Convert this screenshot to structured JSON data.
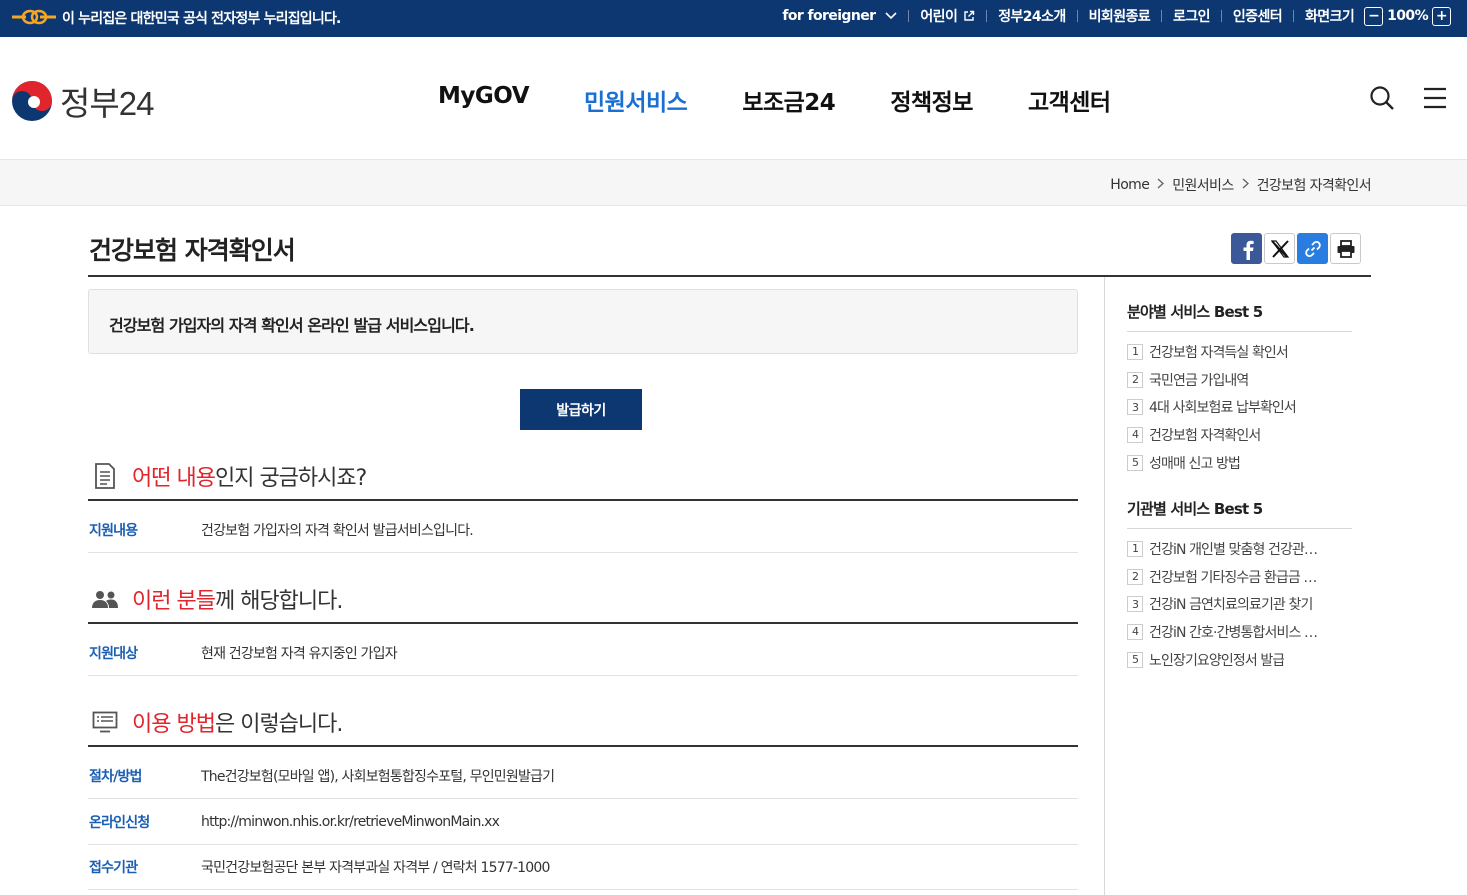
{
  "topbar": {
    "notice": "이 누리집은 대한민국 공식 전자정부 누리집입니다.",
    "foreigner": "for foreigner",
    "kids": "어린이",
    "about": "정부24소개",
    "nonmember_exit": "비회원종료",
    "login": "로그인",
    "cert_center": "인증센터",
    "screen_size": "화면크기",
    "zoom": "100%",
    "zoom_out": "−",
    "zoom_in": "+"
  },
  "header": {
    "logo_text": "정부24",
    "nav": [
      "MyGOV",
      "민원서비스",
      "보조금24",
      "정책정보",
      "고객센터"
    ],
    "active_nav": "민원서비스"
  },
  "breadcrumb": [
    "Home",
    "민원서비스",
    "건강보험 자격확인서"
  ],
  "page": {
    "title": "건강보험 자격확인서",
    "summary": "건강보험 가입자의 자격 확인서 온라인 발급 서비스입니다.",
    "issue_button": "발급하기"
  },
  "sections": {
    "what": {
      "highlight": "어떤 내용",
      "rest": "인지 궁금하시죠?"
    },
    "who": {
      "highlight": "이런 분들",
      "rest": "께 해당합니다."
    },
    "how": {
      "highlight": "이용 방법",
      "rest": "은 이렇습니다."
    }
  },
  "rows": {
    "support_content": {
      "label": "지원내용",
      "value": "건강보험 가입자의 자격 확인서 발급서비스입니다."
    },
    "support_target": {
      "label": "지원대상",
      "value": "현재 건강보험 자격 유지중인 가입자"
    },
    "procedure": {
      "label": "절차/방법",
      "value": "The건강보험(모바일 앱), 사회보험통합징수포털, 무인민원발급기"
    },
    "online": {
      "label": "온라인신청",
      "value": "http://minwon.nhis.or.kr/retrieveMinwonMain.xx"
    },
    "agency": {
      "label": "접수기관",
      "value": "국민건강보험공단 본부 자격부과실 자격부 / 연락처 1577-1000"
    }
  },
  "aside": {
    "field_title": "분야별 서비스 Best 5",
    "field_items": [
      "건강보험 자격득실 확인서",
      "국민연금 가입내역",
      "4대 사회보험료 납부확인서",
      "건강보험 자격확인서",
      "성매매 신고 방법"
    ],
    "agency_title": "기관별 서비스 Best 5",
    "agency_items": [
      "건강iN 개인별 맞춤형 건강관리 서비스",
      "건강보험 기타징수금 환급금 조회",
      "건강iN 금연치료의료기관 찾기",
      "건강iN 간호·간병통합서비스 제공기관",
      "노인장기요양인정서 발급"
    ],
    "numbers": [
      "1",
      "2",
      "3",
      "4",
      "5"
    ]
  },
  "colors": {
    "navy": "#0d3771",
    "accent_blue": "#1a6fd2",
    "highlight_red": "#e0262c",
    "label_blue": "#1a5fb4"
  }
}
